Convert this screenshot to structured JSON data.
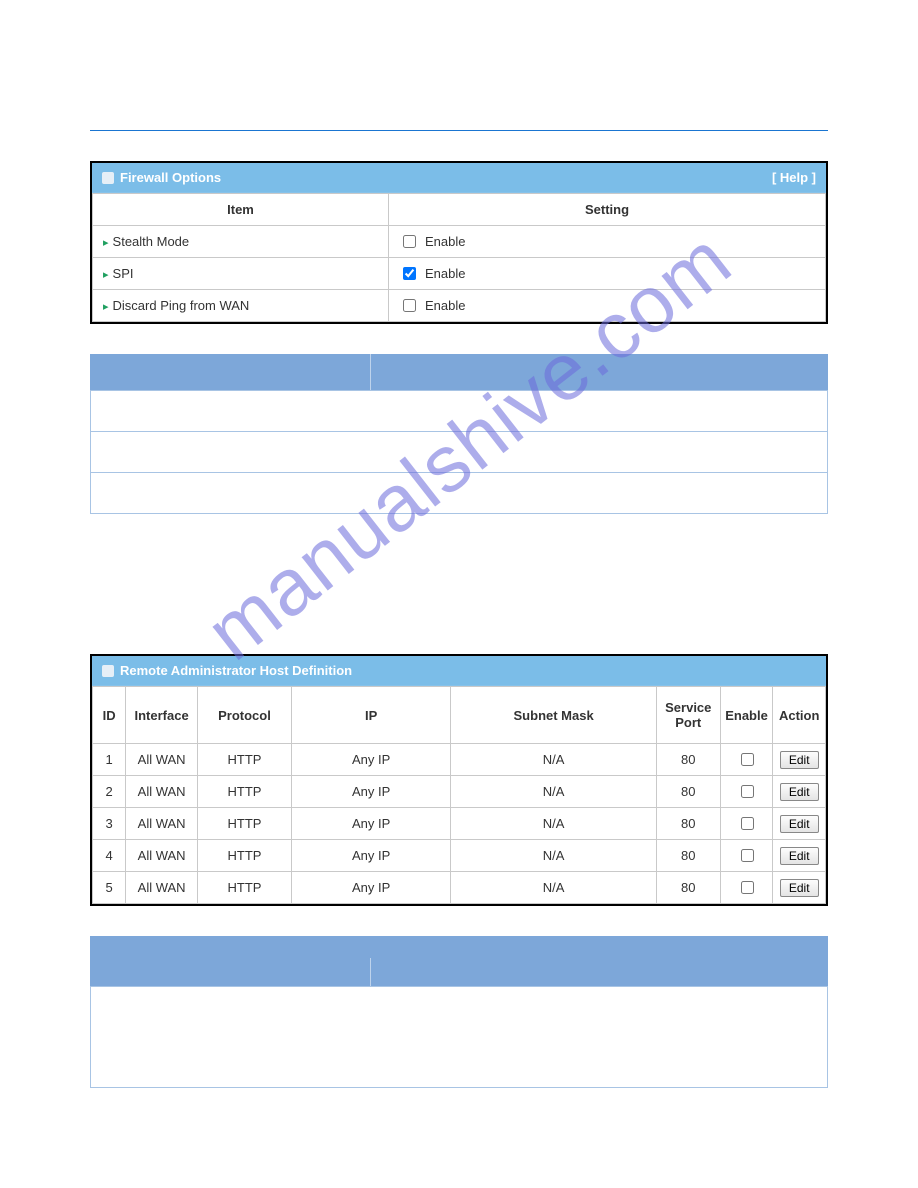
{
  "watermark": "manualshive.com",
  "firewall_panel": {
    "title": "Firewall Options",
    "help": "[ Help ]",
    "headers": {
      "item": "Item",
      "setting": "Setting"
    },
    "enable_label": "Enable",
    "rows": [
      {
        "item": "Stealth Mode",
        "checked": false
      },
      {
        "item": "SPI",
        "checked": true
      },
      {
        "item": "Discard Ping from WAN",
        "checked": false
      }
    ]
  },
  "remote_panel": {
    "title": "Remote Administrator Host Definition",
    "headers": {
      "id": "ID",
      "interface": "Interface",
      "protocol": "Protocol",
      "ip": "IP",
      "subnet": "Subnet Mask",
      "port": "Service Port",
      "enable": "Enable",
      "action": "Action"
    },
    "edit_label": "Edit",
    "rows": [
      {
        "id": "1",
        "interface": "All WAN",
        "protocol": "HTTP",
        "ip": "Any IP",
        "subnet": "N/A",
        "port": "80",
        "enable": false
      },
      {
        "id": "2",
        "interface": "All WAN",
        "protocol": "HTTP",
        "ip": "Any IP",
        "subnet": "N/A",
        "port": "80",
        "enable": false
      },
      {
        "id": "3",
        "interface": "All WAN",
        "protocol": "HTTP",
        "ip": "Any IP",
        "subnet": "N/A",
        "port": "80",
        "enable": false
      },
      {
        "id": "4",
        "interface": "All WAN",
        "protocol": "HTTP",
        "ip": "Any IP",
        "subnet": "N/A",
        "port": "80",
        "enable": false
      },
      {
        "id": "5",
        "interface": "All WAN",
        "protocol": "HTTP",
        "ip": "Any IP",
        "subnet": "N/A",
        "port": "80",
        "enable": false
      }
    ]
  }
}
